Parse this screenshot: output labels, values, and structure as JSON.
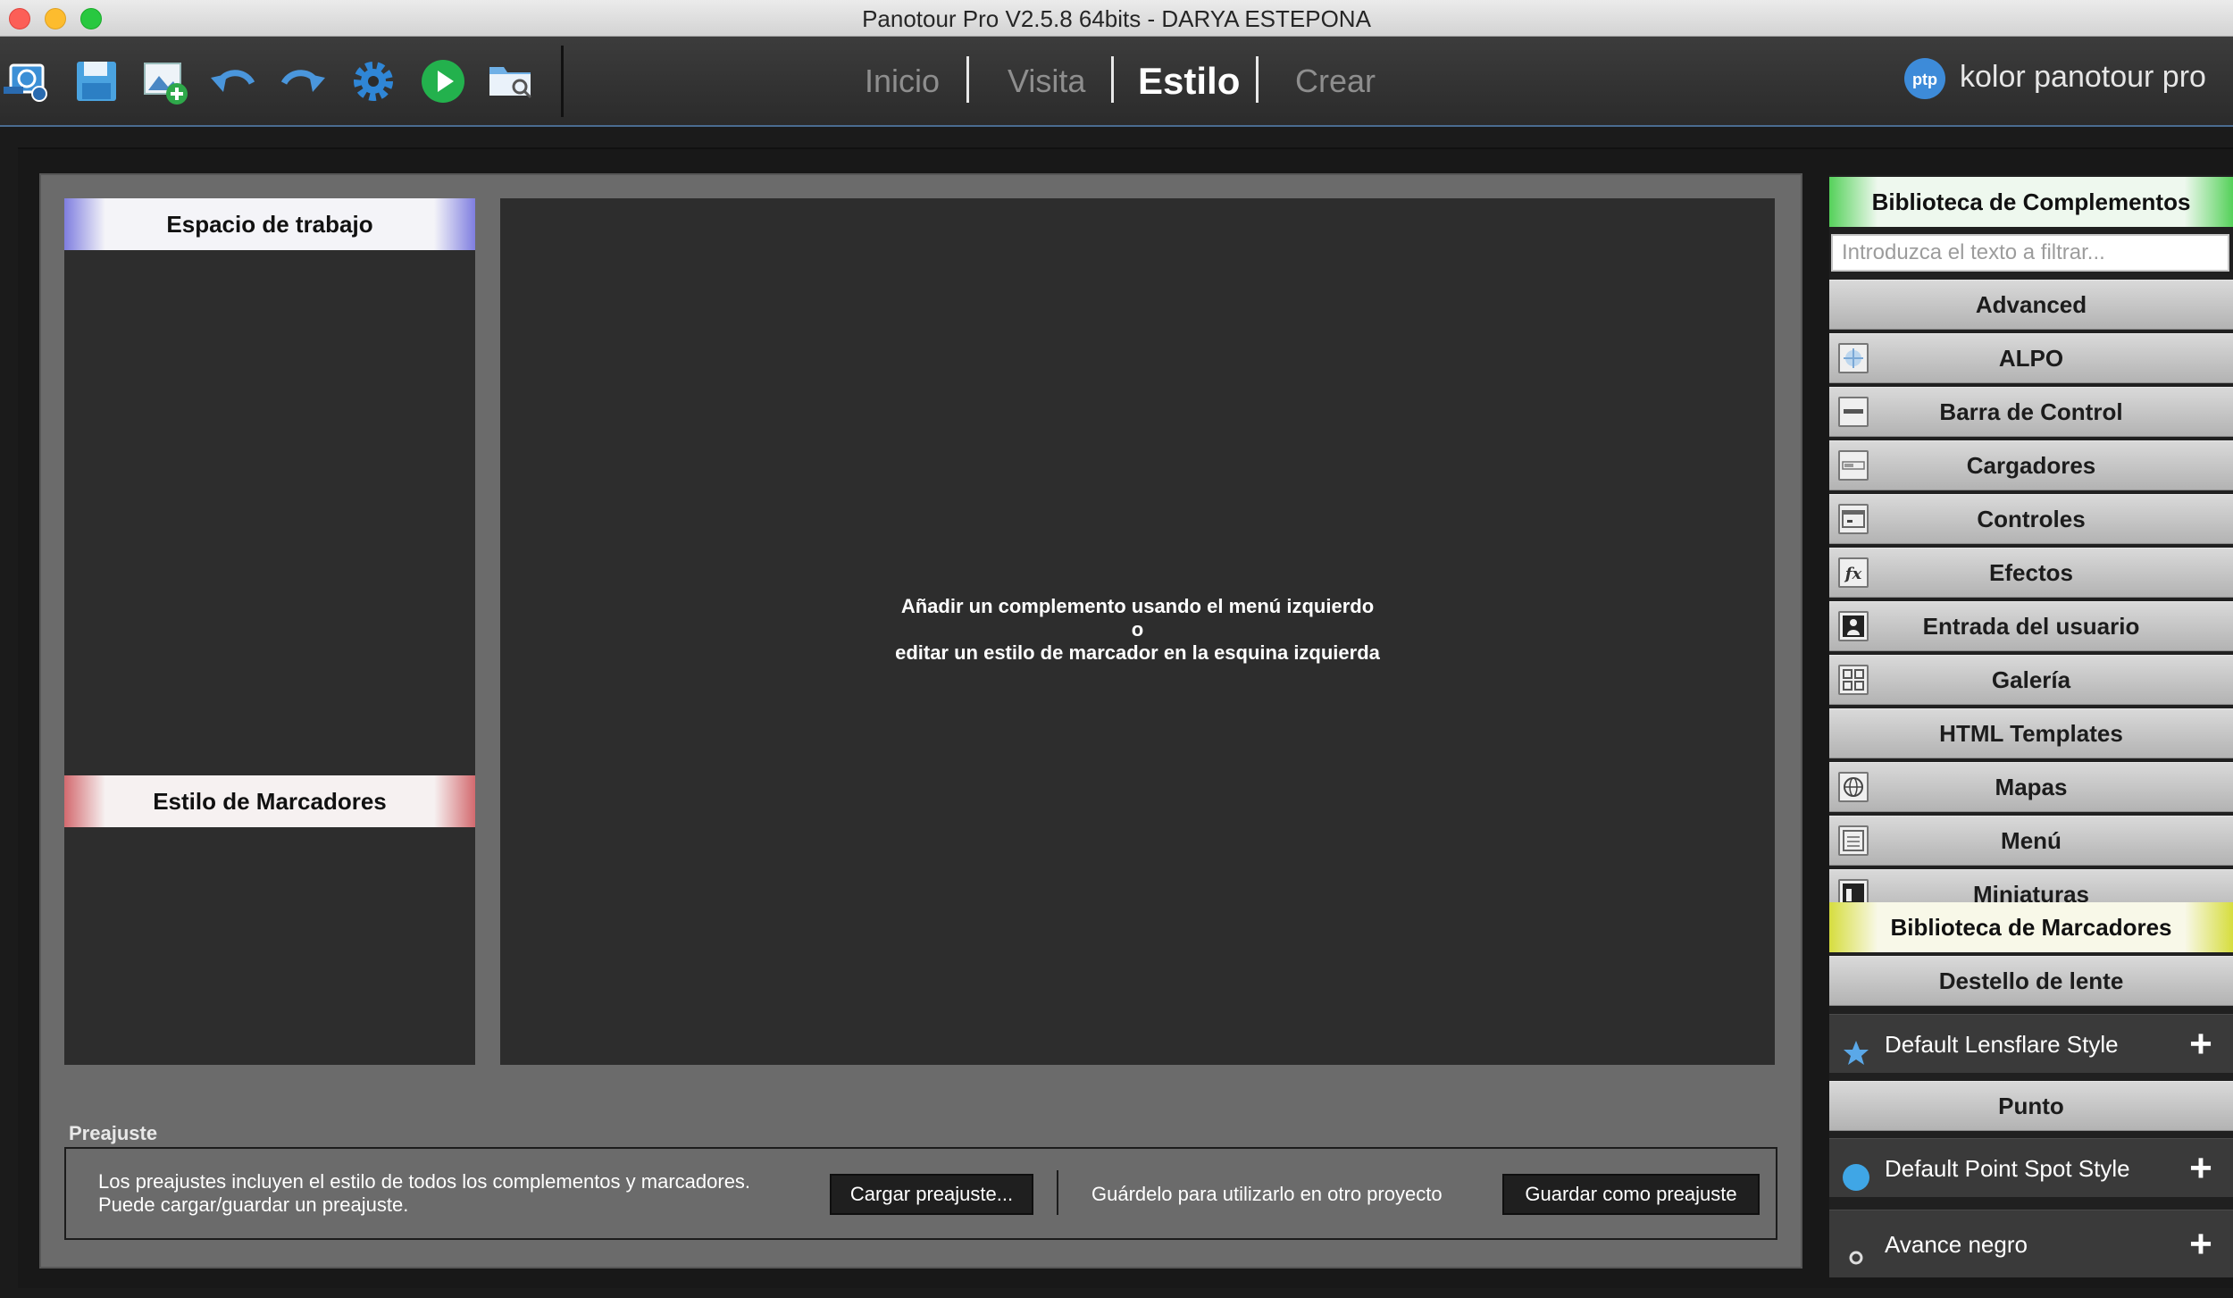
{
  "window": {
    "title": "Panotour Pro V2.5.8 64bits - DARYA ESTEPONA"
  },
  "toolbar": {
    "icons": [
      "new-project-icon",
      "save-icon",
      "add-panorama-icon",
      "undo-icon",
      "redo-icon",
      "settings-icon",
      "play-icon",
      "browse-folder-icon"
    ]
  },
  "nav": {
    "tabs": [
      {
        "label": "Inicio",
        "active": false
      },
      {
        "label": "Visita",
        "active": false
      },
      {
        "label": "Estilo",
        "active": true
      },
      {
        "label": "Crear",
        "active": false
      }
    ]
  },
  "brand": {
    "logo_text": "ptp",
    "name": "kolor panotour pro"
  },
  "left": {
    "workspace_title": "Espacio de trabajo",
    "markers_style_title": "Estilo de Marcadores"
  },
  "preview": {
    "line1": "Añadir un complemento usando el menú izquierdo",
    "line2": "o",
    "line3": "editar un estilo de marcador en la esquina izquierda"
  },
  "preset": {
    "label": "Preajuste",
    "desc1": "Los preajustes incluyen el estilo de todos los complementos y marcadores.",
    "desc2": "Puede cargar/guardar un preajuste.",
    "load_button": "Cargar preajuste...",
    "save_hint": "Guárdelo para utilizarlo en otro proyecto",
    "save_button": "Guardar como preajuste"
  },
  "plugins": {
    "title": "Biblioteca de Complementos",
    "filter_placeholder": "Introduzca el texto a filtrar...",
    "categories": [
      {
        "label": "Advanced",
        "icon": ""
      },
      {
        "label": "ALPO",
        "icon": "alpo-icon"
      },
      {
        "label": "Barra de Control",
        "icon": "control-bar-icon"
      },
      {
        "label": "Cargadores",
        "icon": "loaders-icon"
      },
      {
        "label": "Controles",
        "icon": "controls-icon"
      },
      {
        "label": "Efectos",
        "icon": "effects-fx-icon"
      },
      {
        "label": "Entrada del usuario",
        "icon": "user-input-icon"
      },
      {
        "label": "Galería",
        "icon": "gallery-icon"
      },
      {
        "label": "HTML Templates",
        "icon": ""
      },
      {
        "label": "Mapas",
        "icon": "globe-icon"
      },
      {
        "label": "Menú",
        "icon": "menu-icon"
      },
      {
        "label": "Miniaturas",
        "icon": "thumbnails-icon"
      }
    ]
  },
  "markers": {
    "title": "Biblioteca de Marcadores",
    "lensflare_category": "Destello de lente",
    "lensflare_item": "Default Lensflare Style",
    "point_category": "Punto",
    "point_item": "Default Point Spot Style",
    "avance_item": "Avance negro",
    "add_symbol": "+"
  }
}
